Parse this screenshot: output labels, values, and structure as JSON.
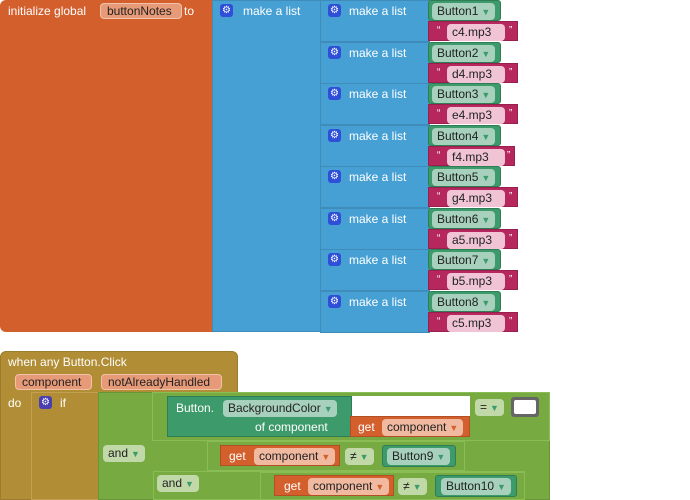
{
  "init": {
    "label": "initialize global",
    "var_name": "buttonNotes",
    "to_label": "to"
  },
  "outer_list_label": "make a list",
  "inner_list_label": "make a list",
  "pairs": [
    {
      "button": "Button1",
      "note": "c4.mp3"
    },
    {
      "button": "Button2",
      "note": "d4.mp3"
    },
    {
      "button": "Button3",
      "note": "e4.mp3"
    },
    {
      "button": "Button4",
      "note": "f4.mp3"
    },
    {
      "button": "Button5",
      "note": "g4.mp3"
    },
    {
      "button": "Button6",
      "note": "a5.mp3"
    },
    {
      "button": "Button7",
      "note": "b5.mp3"
    },
    {
      "button": "Button8",
      "note": "c5.mp3"
    }
  ],
  "event": {
    "title": "when any Button.Click",
    "params": [
      "component",
      "notAlreadyHandled"
    ],
    "do_label": "do",
    "if_label": "if"
  },
  "cond": {
    "button_label": "Button.",
    "property": "BackgroundColor",
    "of_component": "of component",
    "get_label": "get",
    "get_var": "component",
    "eq_op": "=",
    "and_label": "and",
    "neq_op": "≠",
    "btn9": "Button9",
    "btn10": "Button10"
  },
  "colors": {
    "init": "#d25f2c",
    "list": "#47a0d4",
    "component": "#3d9a6a",
    "text": "#b5275d",
    "event": "#b18e35",
    "logic": "#77ab41"
  }
}
